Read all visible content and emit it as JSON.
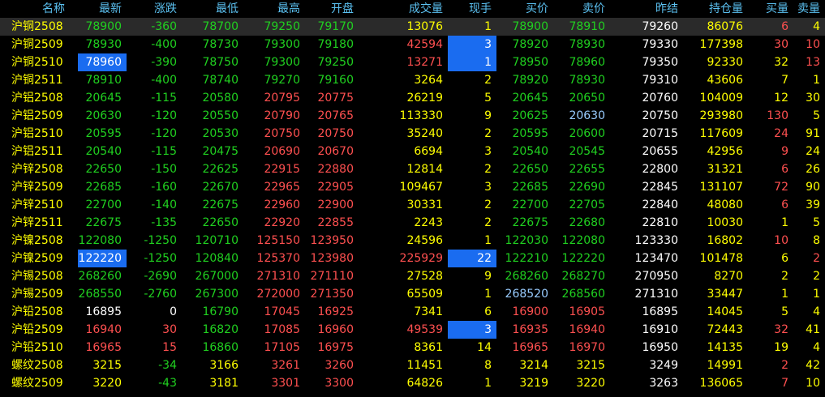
{
  "headers": [
    "名称",
    "最新",
    "涨跌",
    "最低",
    "最高",
    "开盘",
    "成交量",
    "现手",
    "买价",
    "卖价",
    "昨结",
    "持仓量",
    "买量",
    "卖量"
  ],
  "rows": [
    {
      "c": [
        [
          "沪铜2508",
          "yellow"
        ],
        [
          "78900",
          "green"
        ],
        [
          "-360",
          "green"
        ],
        [
          "78700",
          "green"
        ],
        [
          "79250",
          "green"
        ],
        [
          "79170",
          "green"
        ],
        [
          "13076",
          "yellow"
        ],
        [
          "1",
          "yellow"
        ],
        [
          "78900",
          "green"
        ],
        [
          "78910",
          "green"
        ],
        [
          "79260",
          "white"
        ],
        [
          "86076",
          "yellow"
        ],
        [
          "6",
          "red"
        ],
        [
          "4",
          "yellow"
        ]
      ],
      "sel": true
    },
    {
      "c": [
        [
          "沪铜2509",
          "yellow"
        ],
        [
          "78930",
          "green"
        ],
        [
          "-400",
          "green"
        ],
        [
          "78730",
          "green"
        ],
        [
          "79300",
          "green"
        ],
        [
          "79180",
          "green"
        ],
        [
          "42594",
          "red"
        ],
        [
          "3",
          "white"
        ],
        [
          "78920",
          "green"
        ],
        [
          "78930",
          "green"
        ],
        [
          "79330",
          "white"
        ],
        [
          "177398",
          "yellow"
        ],
        [
          "30",
          "red"
        ],
        [
          "10",
          "red"
        ]
      ],
      "hl": [
        7
      ]
    },
    {
      "c": [
        [
          "沪铜2510",
          "yellow"
        ],
        [
          "78960",
          "white"
        ],
        [
          "-390",
          "green"
        ],
        [
          "78750",
          "green"
        ],
        [
          "79300",
          "green"
        ],
        [
          "79250",
          "green"
        ],
        [
          "13271",
          "red"
        ],
        [
          "1",
          "white"
        ],
        [
          "78950",
          "green"
        ],
        [
          "78960",
          "green"
        ],
        [
          "79350",
          "white"
        ],
        [
          "92330",
          "yellow"
        ],
        [
          "32",
          "yellow"
        ],
        [
          "13",
          "red"
        ]
      ],
      "hl": [
        1,
        7
      ]
    },
    {
      "c": [
        [
          "沪铜2511",
          "yellow"
        ],
        [
          "78910",
          "green"
        ],
        [
          "-400",
          "green"
        ],
        [
          "78740",
          "green"
        ],
        [
          "79270",
          "green"
        ],
        [
          "79160",
          "green"
        ],
        [
          "3264",
          "yellow"
        ],
        [
          "2",
          "yellow"
        ],
        [
          "78920",
          "green"
        ],
        [
          "78930",
          "green"
        ],
        [
          "79310",
          "white"
        ],
        [
          "43606",
          "yellow"
        ],
        [
          "7",
          "yellow"
        ],
        [
          "1",
          "yellow"
        ]
      ]
    },
    {
      "c": [
        [
          "沪铝2508",
          "yellow"
        ],
        [
          "20645",
          "green"
        ],
        [
          "-115",
          "green"
        ],
        [
          "20580",
          "green"
        ],
        [
          "20795",
          "red"
        ],
        [
          "20775",
          "red"
        ],
        [
          "26219",
          "yellow"
        ],
        [
          "5",
          "yellow"
        ],
        [
          "20645",
          "green"
        ],
        [
          "20650",
          "green"
        ],
        [
          "20760",
          "white"
        ],
        [
          "104009",
          "yellow"
        ],
        [
          "12",
          "yellow"
        ],
        [
          "30",
          "yellow"
        ]
      ]
    },
    {
      "c": [
        [
          "沪铝2509",
          "yellow"
        ],
        [
          "20630",
          "green"
        ],
        [
          "-120",
          "green"
        ],
        [
          "20550",
          "green"
        ],
        [
          "20790",
          "red"
        ],
        [
          "20765",
          "red"
        ],
        [
          "113330",
          "yellow"
        ],
        [
          "9",
          "yellow"
        ],
        [
          "20625",
          "green"
        ],
        [
          "20630",
          "lightblue"
        ],
        [
          "20750",
          "white"
        ],
        [
          "293980",
          "yellow"
        ],
        [
          "130",
          "red"
        ],
        [
          "5",
          "yellow"
        ]
      ]
    },
    {
      "c": [
        [
          "沪铝2510",
          "yellow"
        ],
        [
          "20595",
          "green"
        ],
        [
          "-120",
          "green"
        ],
        [
          "20530",
          "green"
        ],
        [
          "20750",
          "red"
        ],
        [
          "20750",
          "red"
        ],
        [
          "35240",
          "yellow"
        ],
        [
          "2",
          "yellow"
        ],
        [
          "20595",
          "green"
        ],
        [
          "20600",
          "green"
        ],
        [
          "20715",
          "white"
        ],
        [
          "117609",
          "yellow"
        ],
        [
          "24",
          "red"
        ],
        [
          "91",
          "yellow"
        ]
      ]
    },
    {
      "c": [
        [
          "沪铝2511",
          "yellow"
        ],
        [
          "20540",
          "green"
        ],
        [
          "-115",
          "green"
        ],
        [
          "20475",
          "green"
        ],
        [
          "20690",
          "red"
        ],
        [
          "20670",
          "red"
        ],
        [
          "6694",
          "yellow"
        ],
        [
          "3",
          "yellow"
        ],
        [
          "20540",
          "green"
        ],
        [
          "20545",
          "green"
        ],
        [
          "20655",
          "white"
        ],
        [
          "42956",
          "yellow"
        ],
        [
          "9",
          "red"
        ],
        [
          "24",
          "yellow"
        ]
      ]
    },
    {
      "c": [
        [
          "沪锌2508",
          "yellow"
        ],
        [
          "22650",
          "green"
        ],
        [
          "-150",
          "green"
        ],
        [
          "22625",
          "green"
        ],
        [
          "22915",
          "red"
        ],
        [
          "22880",
          "red"
        ],
        [
          "12814",
          "yellow"
        ],
        [
          "2",
          "yellow"
        ],
        [
          "22650",
          "green"
        ],
        [
          "22655",
          "green"
        ],
        [
          "22800",
          "white"
        ],
        [
          "31321",
          "yellow"
        ],
        [
          "6",
          "red"
        ],
        [
          "26",
          "yellow"
        ]
      ]
    },
    {
      "c": [
        [
          "沪锌2509",
          "yellow"
        ],
        [
          "22685",
          "green"
        ],
        [
          "-160",
          "green"
        ],
        [
          "22670",
          "green"
        ],
        [
          "22965",
          "red"
        ],
        [
          "22905",
          "red"
        ],
        [
          "109467",
          "yellow"
        ],
        [
          "3",
          "yellow"
        ],
        [
          "22685",
          "green"
        ],
        [
          "22690",
          "green"
        ],
        [
          "22845",
          "white"
        ],
        [
          "131107",
          "yellow"
        ],
        [
          "72",
          "red"
        ],
        [
          "90",
          "yellow"
        ]
      ]
    },
    {
      "c": [
        [
          "沪锌2510",
          "yellow"
        ],
        [
          "22700",
          "green"
        ],
        [
          "-140",
          "green"
        ],
        [
          "22675",
          "green"
        ],
        [
          "22960",
          "red"
        ],
        [
          "22900",
          "red"
        ],
        [
          "30331",
          "yellow"
        ],
        [
          "2",
          "yellow"
        ],
        [
          "22700",
          "green"
        ],
        [
          "22705",
          "green"
        ],
        [
          "22840",
          "white"
        ],
        [
          "48080",
          "yellow"
        ],
        [
          "6",
          "red"
        ],
        [
          "39",
          "yellow"
        ]
      ]
    },
    {
      "c": [
        [
          "沪锌2511",
          "yellow"
        ],
        [
          "22675",
          "green"
        ],
        [
          "-135",
          "green"
        ],
        [
          "22650",
          "green"
        ],
        [
          "22920",
          "red"
        ],
        [
          "22855",
          "red"
        ],
        [
          "2243",
          "yellow"
        ],
        [
          "2",
          "yellow"
        ],
        [
          "22675",
          "green"
        ],
        [
          "22680",
          "green"
        ],
        [
          "22810",
          "white"
        ],
        [
          "10030",
          "yellow"
        ],
        [
          "1",
          "yellow"
        ],
        [
          "5",
          "yellow"
        ]
      ]
    },
    {
      "c": [
        [
          "沪镍2508",
          "yellow"
        ],
        [
          "122080",
          "green"
        ],
        [
          "-1250",
          "green"
        ],
        [
          "120710",
          "green"
        ],
        [
          "125150",
          "red"
        ],
        [
          "123950",
          "red"
        ],
        [
          "24596",
          "yellow"
        ],
        [
          "1",
          "yellow"
        ],
        [
          "122030",
          "green"
        ],
        [
          "122080",
          "green"
        ],
        [
          "123330",
          "white"
        ],
        [
          "16802",
          "yellow"
        ],
        [
          "10",
          "red"
        ],
        [
          "8",
          "yellow"
        ]
      ]
    },
    {
      "c": [
        [
          "沪镍2509",
          "yellow"
        ],
        [
          "122220",
          "white"
        ],
        [
          "-1250",
          "green"
        ],
        [
          "120840",
          "green"
        ],
        [
          "125370",
          "red"
        ],
        [
          "123980",
          "red"
        ],
        [
          "225929",
          "red"
        ],
        [
          "22",
          "white"
        ],
        [
          "122210",
          "green"
        ],
        [
          "122220",
          "green"
        ],
        [
          "123470",
          "white"
        ],
        [
          "101478",
          "yellow"
        ],
        [
          "6",
          "yellow"
        ],
        [
          "2",
          "red"
        ]
      ],
      "hl": [
        1,
        7
      ]
    },
    {
      "c": [
        [
          "沪锡2508",
          "yellow"
        ],
        [
          "268260",
          "green"
        ],
        [
          "-2690",
          "green"
        ],
        [
          "267000",
          "green"
        ],
        [
          "271310",
          "red"
        ],
        [
          "271110",
          "red"
        ],
        [
          "27528",
          "yellow"
        ],
        [
          "9",
          "yellow"
        ],
        [
          "268260",
          "green"
        ],
        [
          "268270",
          "green"
        ],
        [
          "270950",
          "white"
        ],
        [
          "8270",
          "yellow"
        ],
        [
          "2",
          "yellow"
        ],
        [
          "2",
          "yellow"
        ]
      ]
    },
    {
      "c": [
        [
          "沪锡2509",
          "yellow"
        ],
        [
          "268550",
          "green"
        ],
        [
          "-2760",
          "green"
        ],
        [
          "267300",
          "green"
        ],
        [
          "272000",
          "red"
        ],
        [
          "271350",
          "red"
        ],
        [
          "65509",
          "yellow"
        ],
        [
          "1",
          "yellow"
        ],
        [
          "268520",
          "lightblue"
        ],
        [
          "268560",
          "green"
        ],
        [
          "271310",
          "white"
        ],
        [
          "33447",
          "yellow"
        ],
        [
          "1",
          "yellow"
        ],
        [
          "1",
          "yellow"
        ]
      ]
    },
    {
      "c": [
        [
          "沪铅2508",
          "yellow"
        ],
        [
          "16895",
          "white"
        ],
        [
          "0",
          "white"
        ],
        [
          "16790",
          "green"
        ],
        [
          "17045",
          "red"
        ],
        [
          "16925",
          "red"
        ],
        [
          "7341",
          "yellow"
        ],
        [
          "6",
          "yellow"
        ],
        [
          "16900",
          "red"
        ],
        [
          "16905",
          "red"
        ],
        [
          "16895",
          "white"
        ],
        [
          "14045",
          "yellow"
        ],
        [
          "5",
          "yellow"
        ],
        [
          "4",
          "yellow"
        ]
      ]
    },
    {
      "c": [
        [
          "沪铅2509",
          "yellow"
        ],
        [
          "16940",
          "red"
        ],
        [
          "30",
          "red"
        ],
        [
          "16820",
          "green"
        ],
        [
          "17085",
          "red"
        ],
        [
          "16960",
          "red"
        ],
        [
          "49539",
          "red"
        ],
        [
          "3",
          "white"
        ],
        [
          "16935",
          "red"
        ],
        [
          "16940",
          "red"
        ],
        [
          "16910",
          "white"
        ],
        [
          "72443",
          "yellow"
        ],
        [
          "32",
          "red"
        ],
        [
          "41",
          "yellow"
        ]
      ],
      "hl": [
        7
      ]
    },
    {
      "c": [
        [
          "沪铅2510",
          "yellow"
        ],
        [
          "16965",
          "red"
        ],
        [
          "15",
          "red"
        ],
        [
          "16860",
          "green"
        ],
        [
          "17105",
          "red"
        ],
        [
          "16975",
          "red"
        ],
        [
          "8361",
          "yellow"
        ],
        [
          "14",
          "yellow"
        ],
        [
          "16965",
          "red"
        ],
        [
          "16970",
          "red"
        ],
        [
          "16950",
          "white"
        ],
        [
          "14135",
          "yellow"
        ],
        [
          "19",
          "yellow"
        ],
        [
          "4",
          "yellow"
        ]
      ]
    },
    {
      "c": [
        [
          "螺纹2508",
          "yellow"
        ],
        [
          "3215",
          "yellow"
        ],
        [
          "-34",
          "green"
        ],
        [
          "3166",
          "yellow"
        ],
        [
          "3261",
          "red"
        ],
        [
          "3260",
          "red"
        ],
        [
          "11451",
          "yellow"
        ],
        [
          "8",
          "yellow"
        ],
        [
          "3214",
          "yellow"
        ],
        [
          "3215",
          "yellow"
        ],
        [
          "3249",
          "white"
        ],
        [
          "14991",
          "yellow"
        ],
        [
          "2",
          "red"
        ],
        [
          "42",
          "yellow"
        ]
      ]
    },
    {
      "c": [
        [
          "螺纹2509",
          "yellow"
        ],
        [
          "3220",
          "yellow"
        ],
        [
          "-43",
          "green"
        ],
        [
          "3181",
          "yellow"
        ],
        [
          "3301",
          "red"
        ],
        [
          "3300",
          "red"
        ],
        [
          "64826",
          "yellow"
        ],
        [
          "1",
          "yellow"
        ],
        [
          "3219",
          "yellow"
        ],
        [
          "3220",
          "yellow"
        ],
        [
          "3263",
          "white"
        ],
        [
          "136065",
          "yellow"
        ],
        [
          "7",
          "red"
        ],
        [
          "10",
          "yellow"
        ]
      ]
    }
  ]
}
